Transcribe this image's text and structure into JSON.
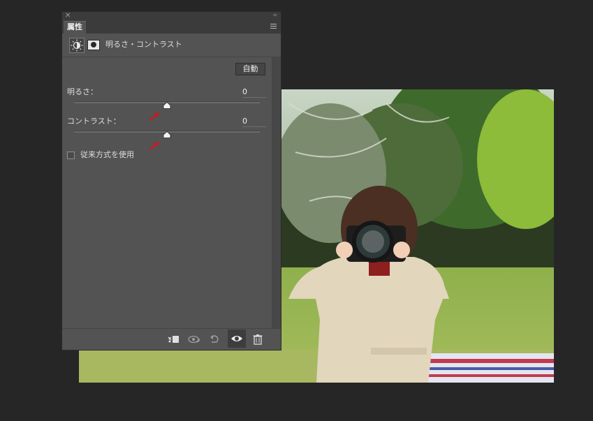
{
  "panel": {
    "tab_label": "属性",
    "adjustment_title": "明るさ・コントラスト",
    "auto_button_label": "自動",
    "brightness": {
      "label": "明るさ：",
      "value": "0",
      "slider_fraction": 0.5
    },
    "contrast": {
      "label": "コントラスト：",
      "value": "0",
      "slider_fraction": 0.5
    },
    "legacy_checkbox": {
      "label": "従来方式を使用",
      "checked": false
    }
  },
  "icons": {
    "close": "close-icon",
    "collapse": "collapse-icon",
    "panel_menu": "panel-menu-icon",
    "adjustment": "brightness-contrast-icon",
    "mask": "layer-mask-icon",
    "clip": "clip-to-layer-icon",
    "view_previous": "view-previous-state-icon",
    "reset": "reset-icon",
    "visibility": "eye-icon",
    "delete": "trash-icon"
  },
  "colors": {
    "background": "#262626",
    "panel": "#535353",
    "annotation_arrow": "#d8141a"
  }
}
